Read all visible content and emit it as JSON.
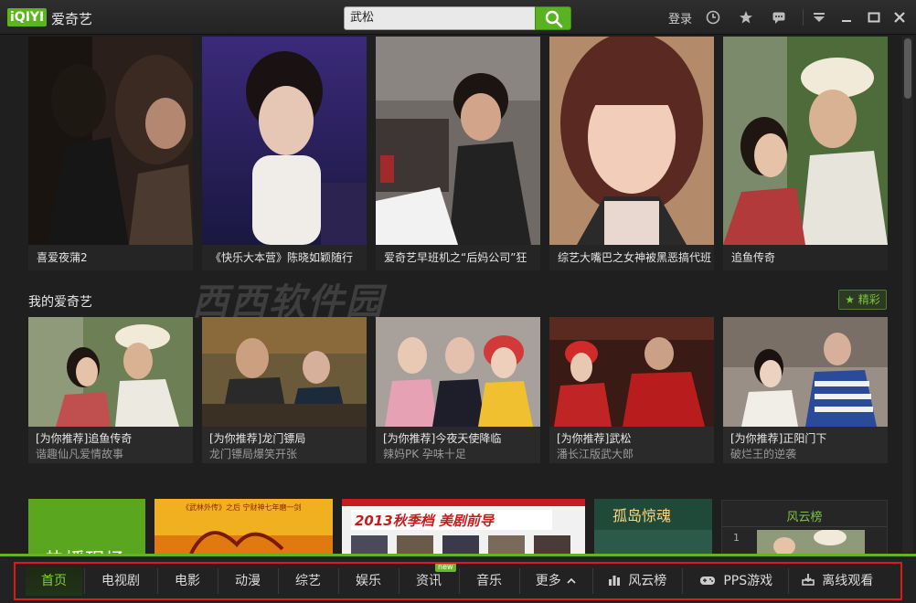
{
  "window": {
    "logo_text": "iQIYI",
    "app_name": "爱奇艺",
    "search_value": "武松",
    "login_label": "登录"
  },
  "top_posters": [
    {
      "caption": "喜爱夜蒲2"
    },
    {
      "caption": "《快乐大本营》陈晓如颖随行"
    },
    {
      "caption": "爱奇艺早班机之“后妈公司”狂"
    },
    {
      "caption": "综艺大嘴巴之女神被黑恶搞代班"
    },
    {
      "caption": "追鱼传奇"
    }
  ],
  "section": {
    "title": "我的爱奇艺",
    "featured_label": "精彩"
  },
  "cards": [
    {
      "title": "[为你推荐]追鱼传奇",
      "subtitle": "谐趣仙凡爱情故事"
    },
    {
      "title": "[为你推荐]龙门镖局",
      "subtitle": "龙门镖局爆笑开张"
    },
    {
      "title": "[为你推荐]今夜天使降临",
      "subtitle": "辣妈PK 孕味十足"
    },
    {
      "title": "[为你推荐]武松",
      "subtitle": "潘长江版武大郎"
    },
    {
      "title": "[为你推荐]正阳门下",
      "subtitle": "破烂王的逆袭"
    }
  ],
  "lower": {
    "hot_label": "热播现场",
    "poster_texts": [
      "《武林外传》之后 宁财神七年磨一剑",
      "2013秋季档 美剧前导",
      "孤岛惊魂"
    ],
    "ranking_title": "风云榜",
    "ranking_first": "1"
  },
  "watermark": "西西软件园",
  "nav": {
    "items": [
      "首页",
      "电视剧",
      "电影",
      "动漫",
      "综艺",
      "娱乐",
      "资讯",
      "音乐",
      "更多",
      "风云榜",
      "PPS游戏",
      "离线观看"
    ],
    "new_badge": "new",
    "active_index": 0
  },
  "colors": {
    "accent": "#5cb51f",
    "active_nav": "#7fd034",
    "highlight_frame": "#e01818"
  }
}
